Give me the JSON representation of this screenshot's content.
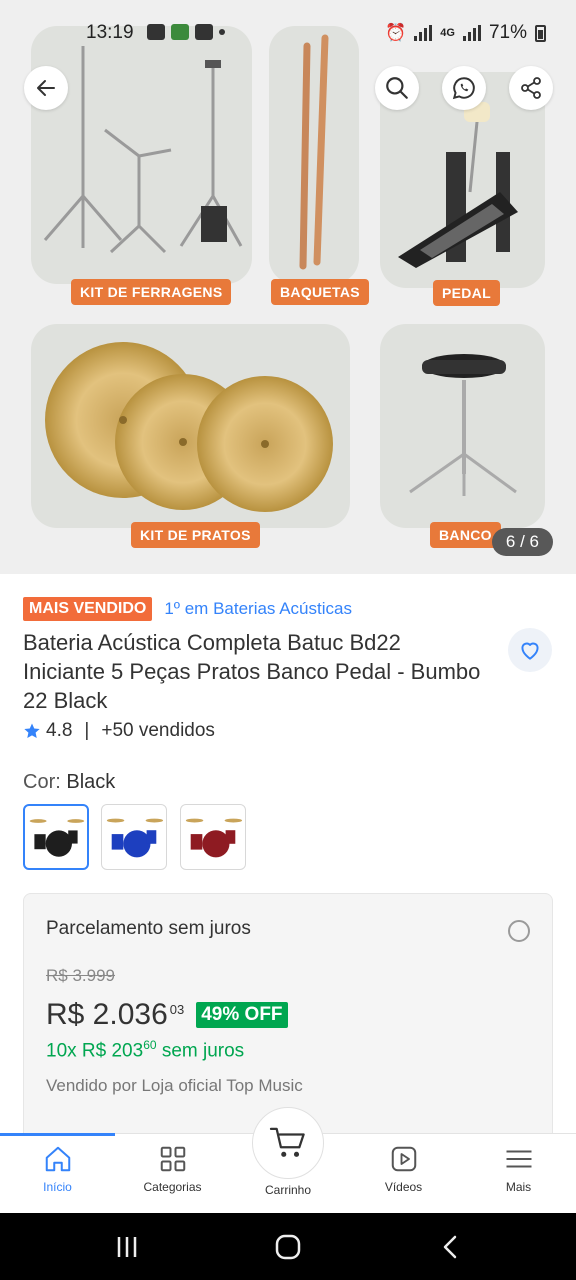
{
  "status_bar": {
    "time": "13:19",
    "battery": "71%",
    "network": "4G"
  },
  "gallery": {
    "labels": {
      "kit_ferragens": "KIT DE FERRAGENS",
      "baquetas": "BAQUETAS",
      "pedal": "PEDAL",
      "kit_pratos": "KIT DE PRATOS",
      "banco": "BANCO"
    },
    "counter": "6 / 6"
  },
  "product": {
    "badge": "MAIS VENDIDO",
    "rank": "1º em Baterias Acústicas",
    "title": "Bateria Acústica Completa Batuc Bd22 Iniciante 5 Peças Pratos Banco Pedal - Bumbo 22 Black",
    "rating": "4.8",
    "sold": "+50 vendidos",
    "color_label": "Cor:",
    "color_value": "Black",
    "swatches": [
      "black",
      "blue",
      "red"
    ]
  },
  "price_card": {
    "title": "Parcelamento sem juros",
    "old_price": "R$ 3.999",
    "price_main": "R$ 2.036",
    "price_cents": "03",
    "discount": "49% OFF",
    "installment_prefix": "10x R$ 203",
    "installment_cents": "60",
    "installment_suffix": "sem juros",
    "seller": "Vendido por Loja oficial Top Music"
  },
  "bottom_nav": {
    "home": "Início",
    "categories": "Categorias",
    "cart": "Carrinho",
    "videos": "Vídeos",
    "more": "Mais"
  },
  "colors": {
    "accent": "#3483fa",
    "green": "#00a650",
    "orange_badge": "#f26c3a",
    "gallery_tag": "#e8793a"
  }
}
